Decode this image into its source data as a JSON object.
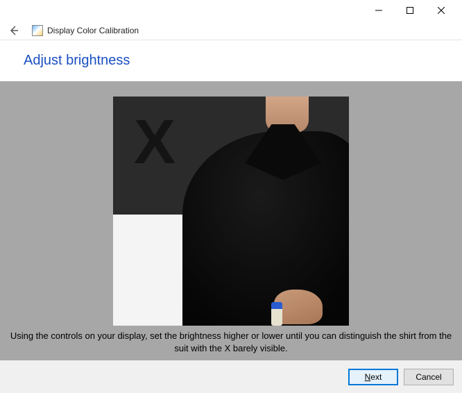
{
  "window": {
    "title": "Display Color Calibration",
    "controls": {
      "minimize": "minimize",
      "maximize": "maximize",
      "close": "close"
    }
  },
  "header": {
    "back_label": "Back"
  },
  "page": {
    "title": "Adjust brightness",
    "instruction": "Using the controls on your display, set the brightness higher or lower until you can distinguish the shirt from the suit with the X barely visible."
  },
  "sample": {
    "x_glyph": "X"
  },
  "footer": {
    "next_prefix": "N",
    "next_rest": "ext",
    "cancel_label": "Cancel"
  }
}
